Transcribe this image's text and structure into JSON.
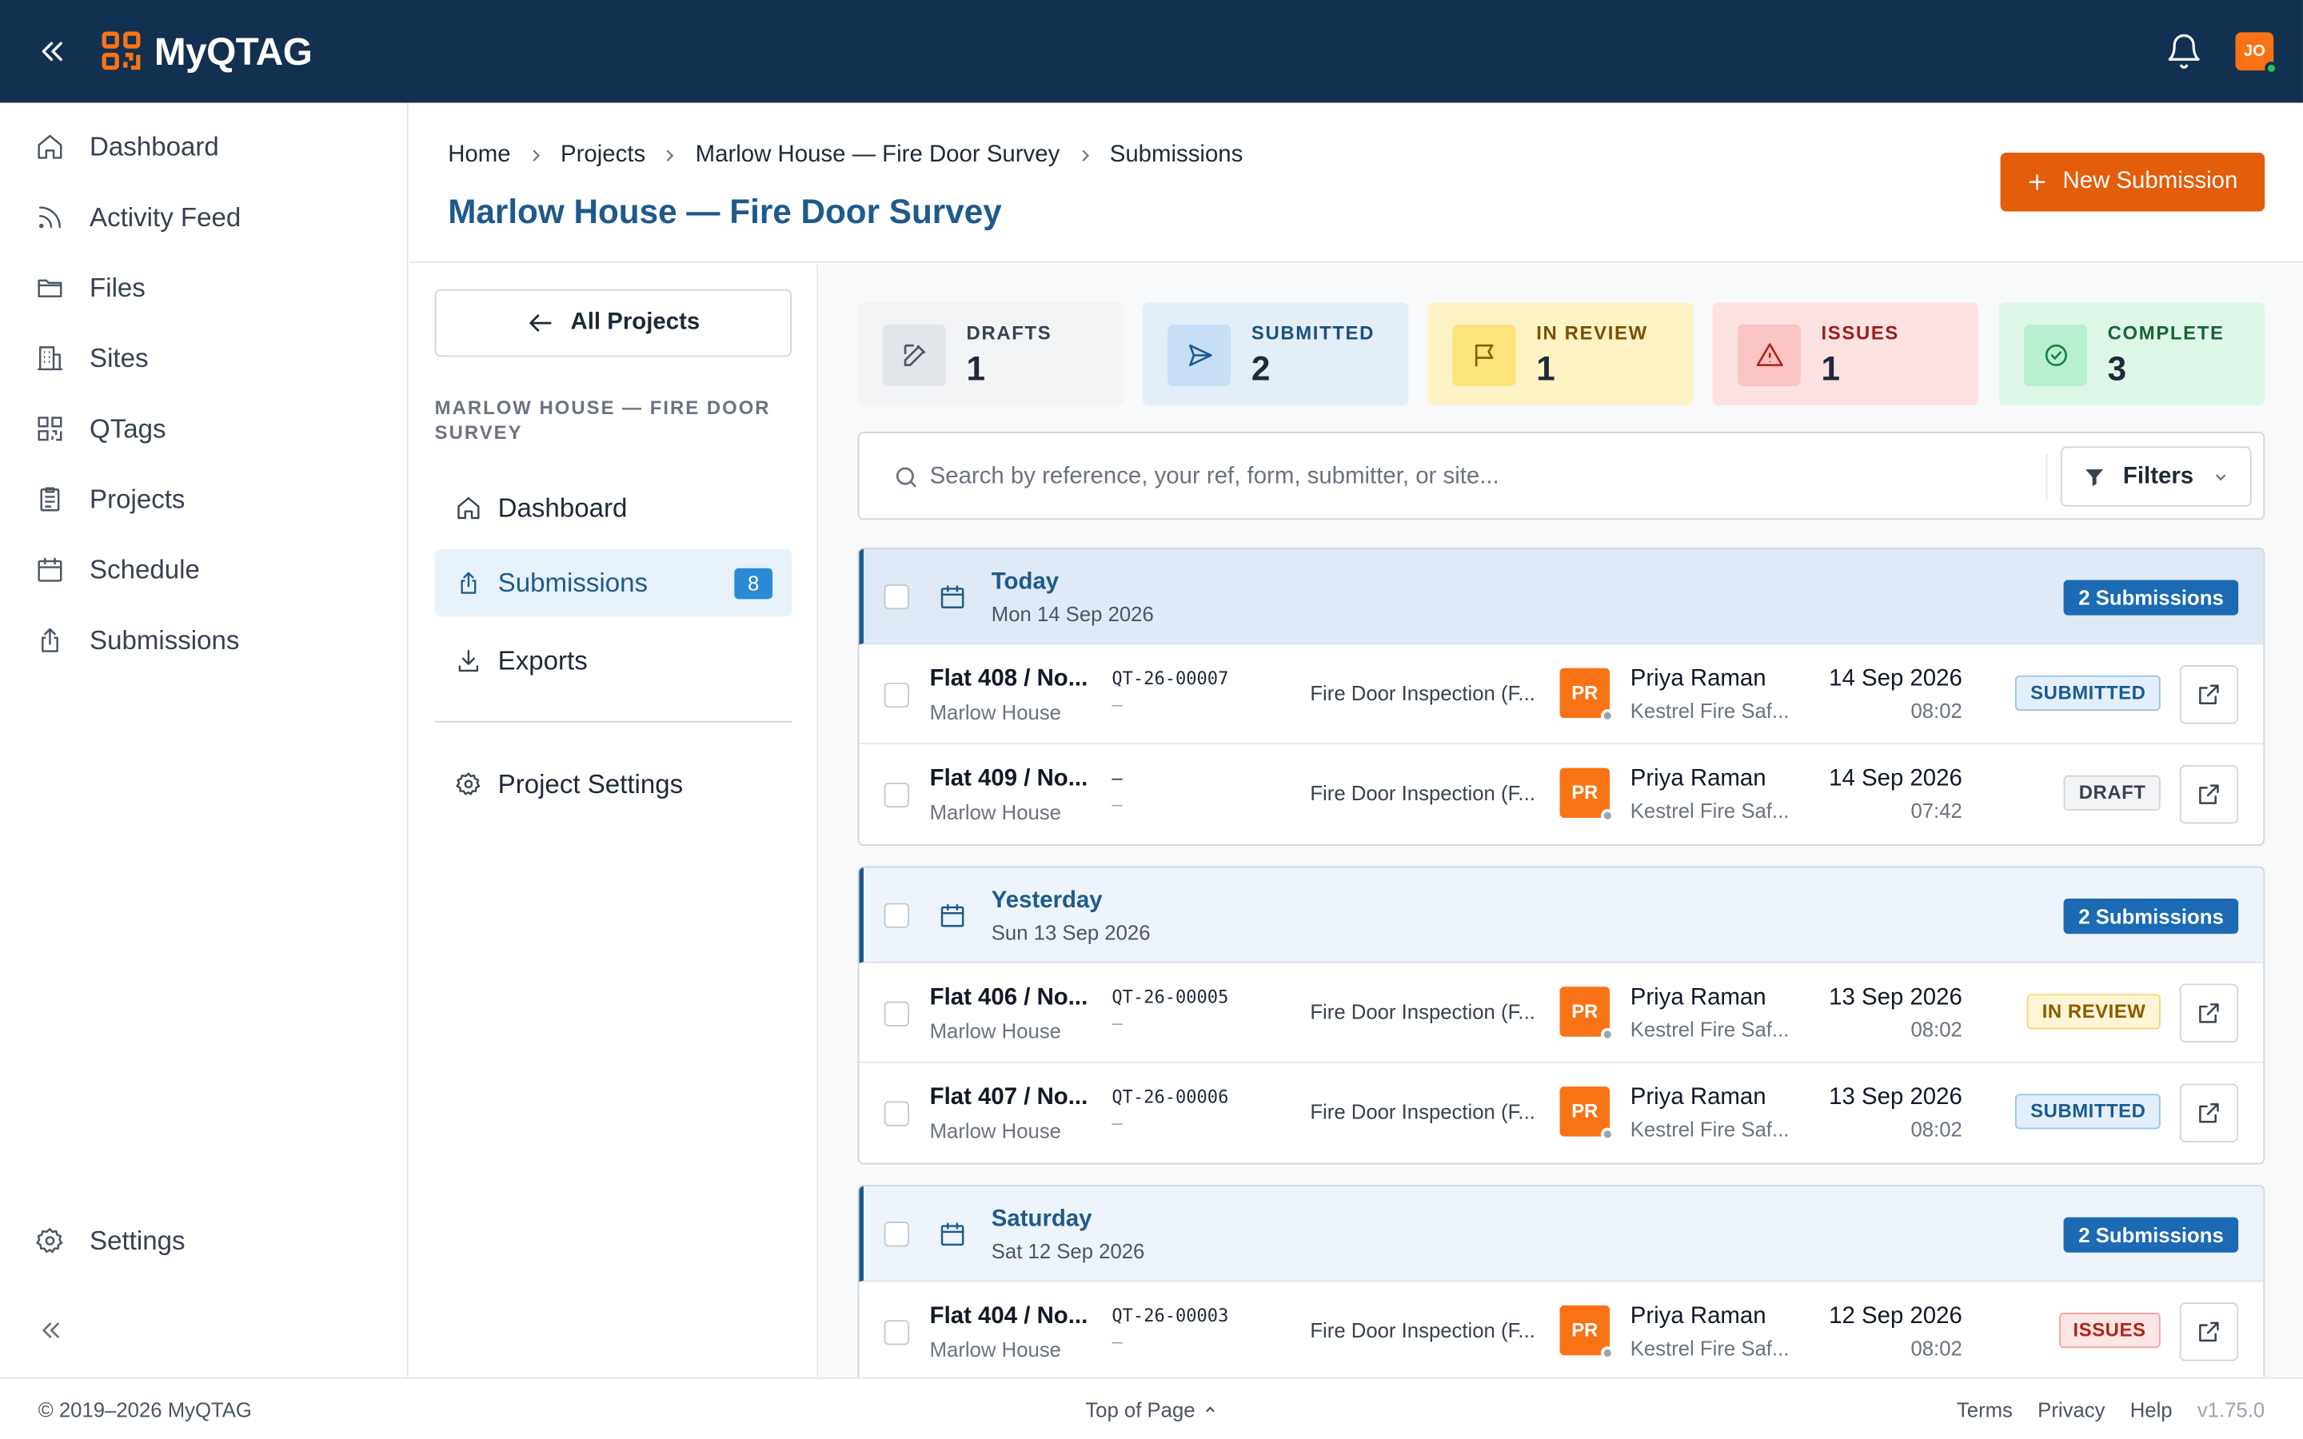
{
  "app": {
    "brand": "MyQTAG",
    "avatar_initials": "JO"
  },
  "sidebar": {
    "items": [
      {
        "label": "Dashboard",
        "icon": "home-icon"
      },
      {
        "label": "Activity Feed",
        "icon": "rss-icon"
      },
      {
        "label": "Files",
        "icon": "folder-icon"
      },
      {
        "label": "Sites",
        "icon": "building-icon"
      },
      {
        "label": "QTags",
        "icon": "qr-icon"
      },
      {
        "label": "Projects",
        "icon": "clipboard-icon"
      },
      {
        "label": "Schedule",
        "icon": "calendar-icon"
      },
      {
        "label": "Submissions",
        "icon": "upload-icon"
      }
    ],
    "settings_label": "Settings"
  },
  "breadcrumb": [
    "Home",
    "Projects",
    "Marlow House — Fire Door Survey",
    "Submissions"
  ],
  "page_title": "Marlow House — Fire Door Survey",
  "new_submission_label": "New Submission",
  "subnav": {
    "back_label": "All Projects",
    "caption": "MARLOW HOUSE — FIRE DOOR SURVEY",
    "items": [
      {
        "label": "Dashboard"
      },
      {
        "label": "Submissions",
        "badge": "8",
        "active": true
      },
      {
        "label": "Exports"
      }
    ],
    "settings_label": "Project Settings"
  },
  "stats": [
    {
      "label": "DRAFTS",
      "count": "1",
      "color": "#f3f4f6"
    },
    {
      "label": "SUBMITTED",
      "count": "2",
      "color": "#e3eef9"
    },
    {
      "label": "IN REVIEW",
      "count": "1",
      "color": "#fdf3c4"
    },
    {
      "label": "ISSUES",
      "count": "1",
      "color": "#fde2e2"
    },
    {
      "label": "COMPLETE",
      "count": "3",
      "color": "#def7e8"
    }
  ],
  "search": {
    "placeholder": "Search by reference, your ref, form, submitter, or site...",
    "filters_label": "Filters"
  },
  "groups": [
    {
      "title": "Today",
      "date": "Mon 14 Sep 2026",
      "count": "2 Submissions",
      "rows": [
        {
          "title": "Flat 408 / No...",
          "site": "Marlow House",
          "ref": "QT-26-00007",
          "your_ref": "–",
          "form": "Fire Door Inspection (F...",
          "initials": "PR",
          "name": "Priya Raman",
          "org": "Kestrel Fire Saf...",
          "date": "14 Sep 2026",
          "time": "08:02",
          "status": "SUBMITTED"
        },
        {
          "title": "Flat 409 / No...",
          "site": "Marlow House",
          "ref": "–",
          "your_ref": "–",
          "form": "Fire Door Inspection (F...",
          "initials": "PR",
          "name": "Priya Raman",
          "org": "Kestrel Fire Saf...",
          "date": "14 Sep 2026",
          "time": "07:42",
          "status": "DRAFT"
        }
      ]
    },
    {
      "title": "Yesterday",
      "date": "Sun 13 Sep 2026",
      "count": "2 Submissions",
      "rows": [
        {
          "title": "Flat 406 / No...",
          "site": "Marlow House",
          "ref": "QT-26-00005",
          "your_ref": "–",
          "form": "Fire Door Inspection (F...",
          "initials": "PR",
          "name": "Priya Raman",
          "org": "Kestrel Fire Saf...",
          "date": "13 Sep 2026",
          "time": "08:02",
          "status": "IN REVIEW"
        },
        {
          "title": "Flat 407 / No...",
          "site": "Marlow House",
          "ref": "QT-26-00006",
          "your_ref": "–",
          "form": "Fire Door Inspection (F...",
          "initials": "PR",
          "name": "Priya Raman",
          "org": "Kestrel Fire Saf...",
          "date": "13 Sep 2026",
          "time": "08:02",
          "status": "SUBMITTED"
        }
      ]
    },
    {
      "title": "Saturday",
      "date": "Sat 12 Sep 2026",
      "count": "2 Submissions",
      "rows": [
        {
          "title": "Flat 404 / No...",
          "site": "Marlow House",
          "ref": "QT-26-00003",
          "your_ref": "–",
          "form": "Fire Door Inspection (F...",
          "initials": "PR",
          "name": "Priya Raman",
          "org": "Kestrel Fire Saf...",
          "date": "12 Sep 2026",
          "time": "08:02",
          "status": "ISSUES"
        }
      ]
    }
  ],
  "footer": {
    "copyright": "© 2019–2026 MyQTAG",
    "top_link": "Top of Page",
    "terms": "Terms",
    "privacy": "Privacy",
    "help": "Help",
    "version": "v1.75.0"
  }
}
